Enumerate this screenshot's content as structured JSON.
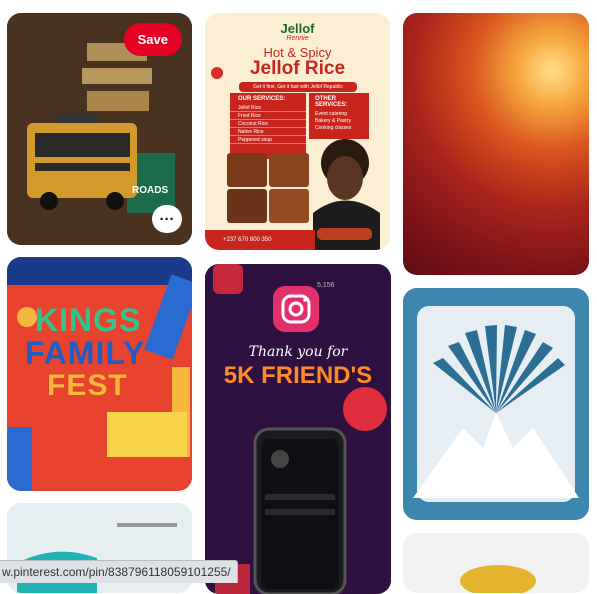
{
  "pins": {
    "pin1": {
      "save_label": "Save",
      "more_label": "···",
      "signs": [
        "ROADS"
      ]
    },
    "pin2": {
      "brand": "Jellof",
      "brand_sub": "Rennie",
      "headline_1": "Hot & Spicy",
      "headline_2": "Jellof Rice",
      "tagline": "Get it first, Get it fast with Jellof Republic",
      "our_services_title": "OUR SERVICES:",
      "our_services": [
        "Jellof Rice",
        "Fried Rice",
        "Coconut Rice",
        "Native Rice",
        "Peppered soup"
      ],
      "other_services_title": "OTHER SERVICES:",
      "other_services": [
        "Event catering",
        "Bakery & Pastry",
        "Cooking classes"
      ],
      "phone": "+237 670 800 350"
    },
    "pin4": {
      "line1": "KINGS",
      "line2": "FAMILY",
      "line3": "FEST"
    },
    "pin5": {
      "script_text": "Thank you for",
      "headline": "5K FRIEND'S",
      "counter": "5,156"
    }
  },
  "status_url": "w.pinterest.com/pin/838796118059101255/",
  "colors": {
    "save_red": "#e60023",
    "jellof_red": "#c8261d",
    "festival_red": "#e8432e",
    "instagram_purple": "#3a1650",
    "mountain_blue": "#3d86ad"
  }
}
